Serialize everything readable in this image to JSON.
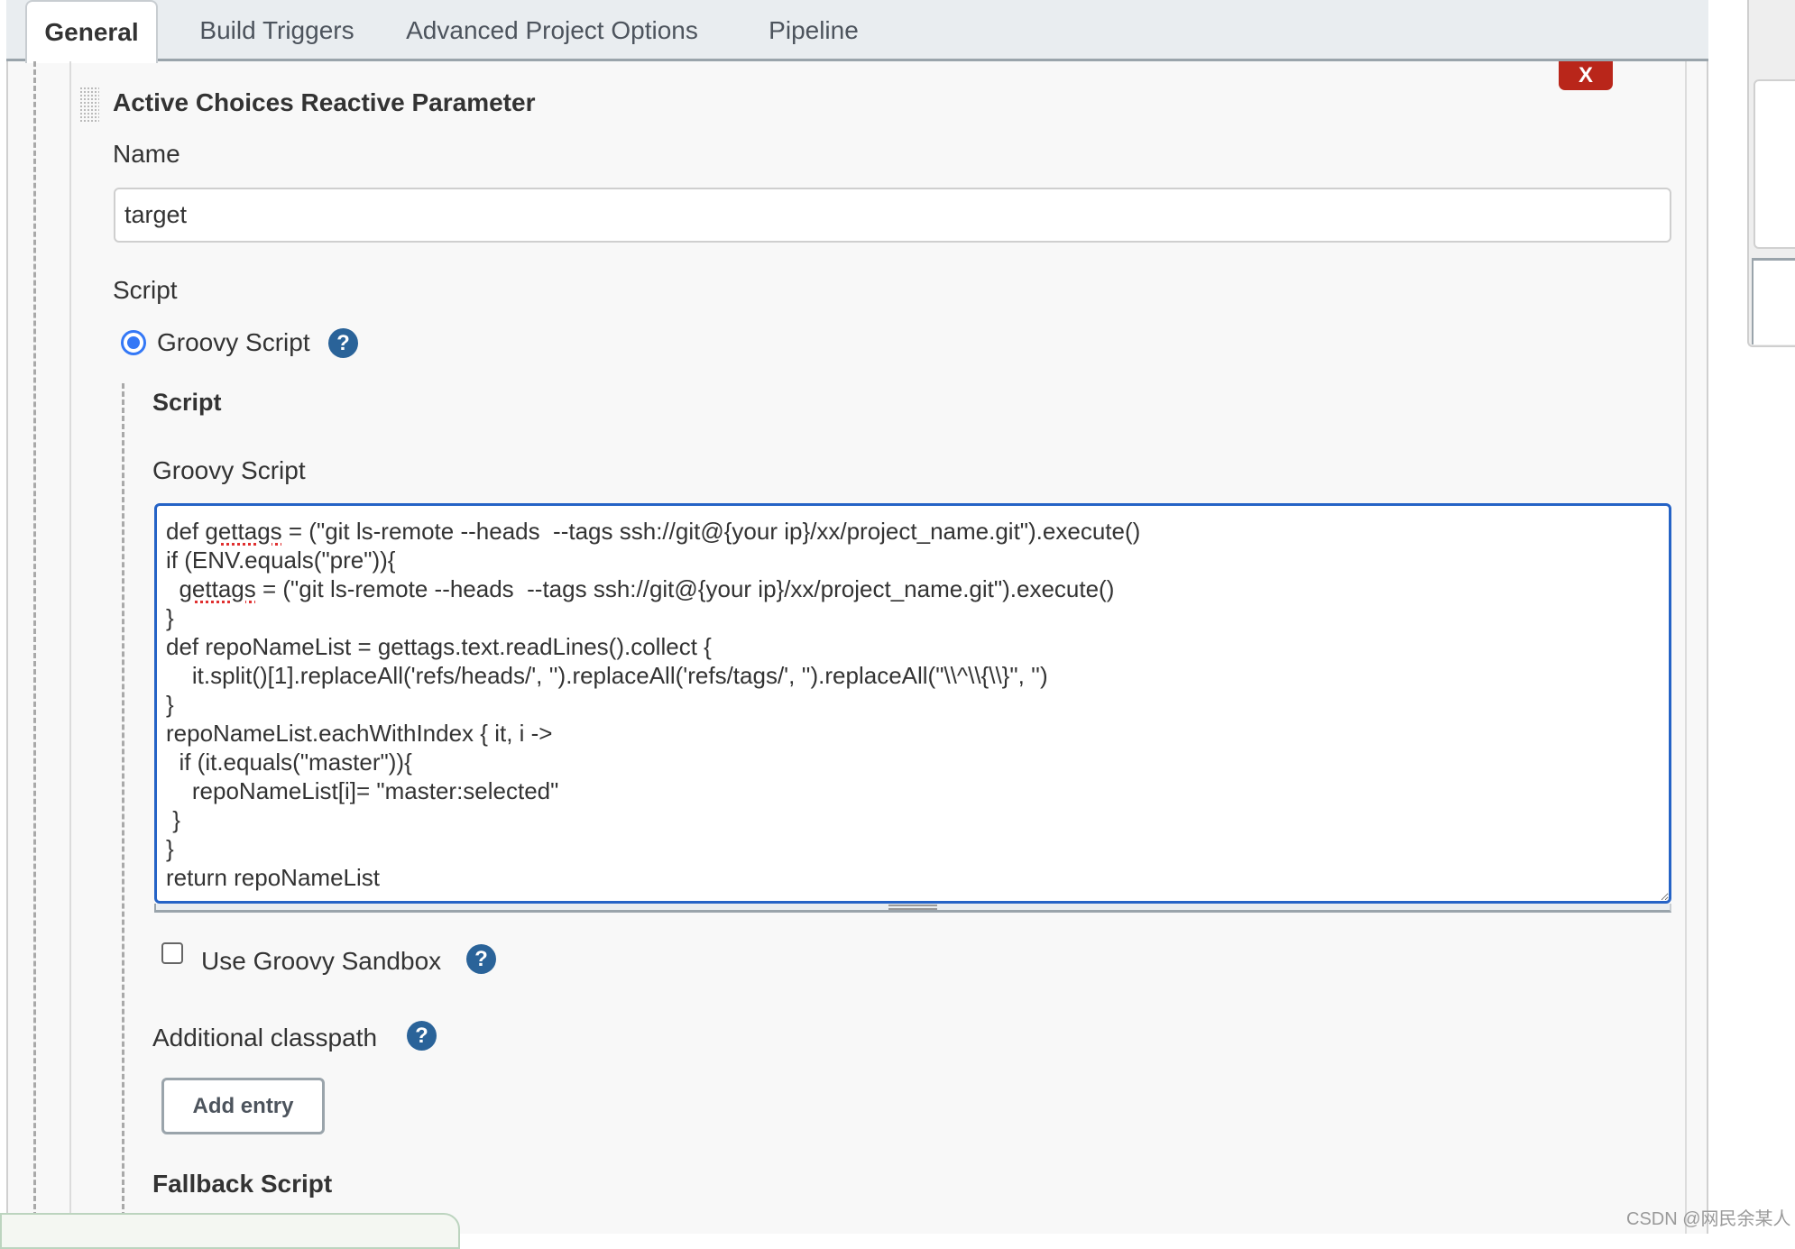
{
  "tabs": [
    {
      "label": "General",
      "active": true
    },
    {
      "label": "Build Triggers",
      "active": false
    },
    {
      "label": "Advanced Project Options",
      "active": false
    },
    {
      "label": "Pipeline",
      "active": false
    }
  ],
  "parameter": {
    "title": "Active Choices Reactive Parameter",
    "delete_label": "X",
    "name_label": "Name",
    "name_value": "target",
    "script_label": "Script",
    "script_type_option": "Groovy Script",
    "script_type_selected": true,
    "script_subheader": "Script",
    "groovy_script_label": "Groovy Script",
    "groovy_script_lines": [
      "def gettags = (\"git ls-remote --heads  --tags ssh://git@{your ip}/xx/project_name.git\").execute()",
      "if (ENV.equals(\"pre\")){",
      "  gettags = (\"git ls-remote --heads  --tags ssh://git@{your ip}/xx/project_name.git\").execute()",
      "}",
      "def repoNameList = gettags.text.readLines().collect {",
      "    it.split()[1].replaceAll('refs/heads/', '').replaceAll('refs/tags/', '').replaceAll(\"\\\\^\\\\{\\\\}\", '')",
      "}",
      "repoNameList.eachWithIndex { it, i ->",
      "  if (it.equals(\"master\")){",
      "    repoNameList[i]= \"master:selected\"",
      " }",
      "}",
      "return repoNameList"
    ],
    "sandbox_label": "Use Groovy Sandbox",
    "sandbox_checked": false,
    "classpath_label": "Additional classpath",
    "add_entry_label": "Add entry",
    "fallback_label": "Fallback Script"
  },
  "help_icon_glyph": "?",
  "icons": {
    "help": "help-icon",
    "drag": "drag-handle-icon",
    "delete": "close-icon"
  },
  "colors": {
    "accent_blue": "#2563c6",
    "help_blue": "#2a6399",
    "delete_red": "#b9261a",
    "radio_blue": "#3478f6"
  },
  "watermark": "CSDN @网民余某人"
}
